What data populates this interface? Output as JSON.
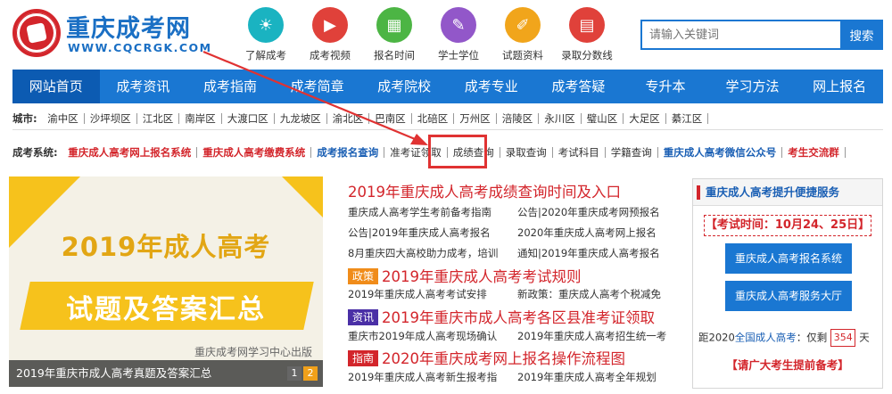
{
  "logo": {
    "title": "重庆成考网",
    "url": "WWW.CQCRGK.COM"
  },
  "quick_links": [
    {
      "label": "了解成考",
      "icon": "lightbulb-icon",
      "color": "#1ab3c1",
      "glyph": "☀"
    },
    {
      "label": "成考视频",
      "icon": "video-icon",
      "color": "#e0413a",
      "glyph": "▶"
    },
    {
      "label": "报名时间",
      "icon": "calendar-icon",
      "color": "#4cb544",
      "glyph": "▦"
    },
    {
      "label": "学士学位",
      "icon": "graduation-icon",
      "color": "#9257c9",
      "glyph": "✎"
    },
    {
      "label": "试题资料",
      "icon": "document-icon",
      "color": "#f1a51b",
      "glyph": "✐"
    },
    {
      "label": "录取分数线",
      "icon": "chart-icon",
      "color": "#e0413a",
      "glyph": "▤"
    }
  ],
  "search": {
    "placeholder": "请输入关键词",
    "button": "搜索"
  },
  "nav": [
    "网站首页",
    "成考资讯",
    "成考指南",
    "成考简章",
    "成考院校",
    "成考专业",
    "成考答疑",
    "专升本",
    "学习方法",
    "网上报名"
  ],
  "cities": {
    "label": "城市:",
    "items": [
      "渝中区",
      "沙坪坝区",
      "江北区",
      "南岸区",
      "大渡口区",
      "九龙坡区",
      "渝北区",
      "巴南区",
      "北碚区",
      "万州区",
      "涪陵区",
      "永川区",
      "璧山区",
      "大足区",
      "綦江区"
    ]
  },
  "systems": {
    "label": "成考系统:",
    "items": [
      {
        "text": "重庆成人高考网上报名系统",
        "style": "red"
      },
      {
        "text": "重庆成人高考缴费系统",
        "style": "red"
      },
      {
        "text": "成考报名查询",
        "style": "blue"
      },
      {
        "text": "准考证领取",
        "style": "normal"
      },
      {
        "text": "成绩查询",
        "style": "normal"
      },
      {
        "text": "录取查询",
        "style": "normal"
      },
      {
        "text": "考试科目",
        "style": "normal"
      },
      {
        "text": "学籍查询",
        "style": "normal"
      },
      {
        "text": "重庆成人高考微信公众号",
        "style": "blue"
      },
      {
        "text": "考生交流群",
        "style": "red"
      }
    ]
  },
  "banner": {
    "title": "2019年成人高考",
    "subtitle": "试题及答案汇总",
    "credit": "重庆成考网学习中心出版",
    "caption": "2019年重庆市成人高考真题及答案汇总",
    "pages": [
      "1",
      "2"
    ]
  },
  "news": {
    "headline1": "2019年重庆成人高考成绩查询时间及入口",
    "pairs1": [
      [
        "重庆成人高考学生考前备考指南",
        "公告|2020年重庆成考网预报名"
      ],
      [
        "公告|2019年重庆成人高考报名",
        "2020年重庆成人高考网上报名"
      ],
      [
        "8月重庆四大高校助力成考，培训",
        "通知|2019年重庆成人高考报名"
      ]
    ],
    "tag2": "政策",
    "headline2": "2019年重庆成人高考考试规则",
    "pairs2": [
      [
        "2019年重庆成人高考考试安排",
        "新政策：重庆成人高考个税减免"
      ]
    ],
    "tag3": "资讯",
    "headline3": "2019年重庆市成人高考各区县准考证领取",
    "pairs3": [
      [
        "重庆市2019年成人高考现场确认",
        "2019年重庆成人高考招生统一考"
      ]
    ],
    "tag4": "指南",
    "headline4": "2020年重庆成考网上报名操作流程图",
    "pairs4": [
      [
        "2019年重庆成人高考新生报考指",
        "2019年重庆成人高考全年规划"
      ]
    ]
  },
  "rbox": {
    "title": "重庆成人高考提升便捷服务",
    "exam_time": "【考试时间：10月24、25日】",
    "btn1": "重庆成人高考报名系统",
    "btn2": "重庆成人高考服务大厅",
    "count_prefix": "距2020",
    "count_link": "全国成人高考",
    "count_mid": "：仅剩",
    "count_days": "354",
    "count_suffix": "天",
    "note": "【请广大考生提前备考】"
  }
}
